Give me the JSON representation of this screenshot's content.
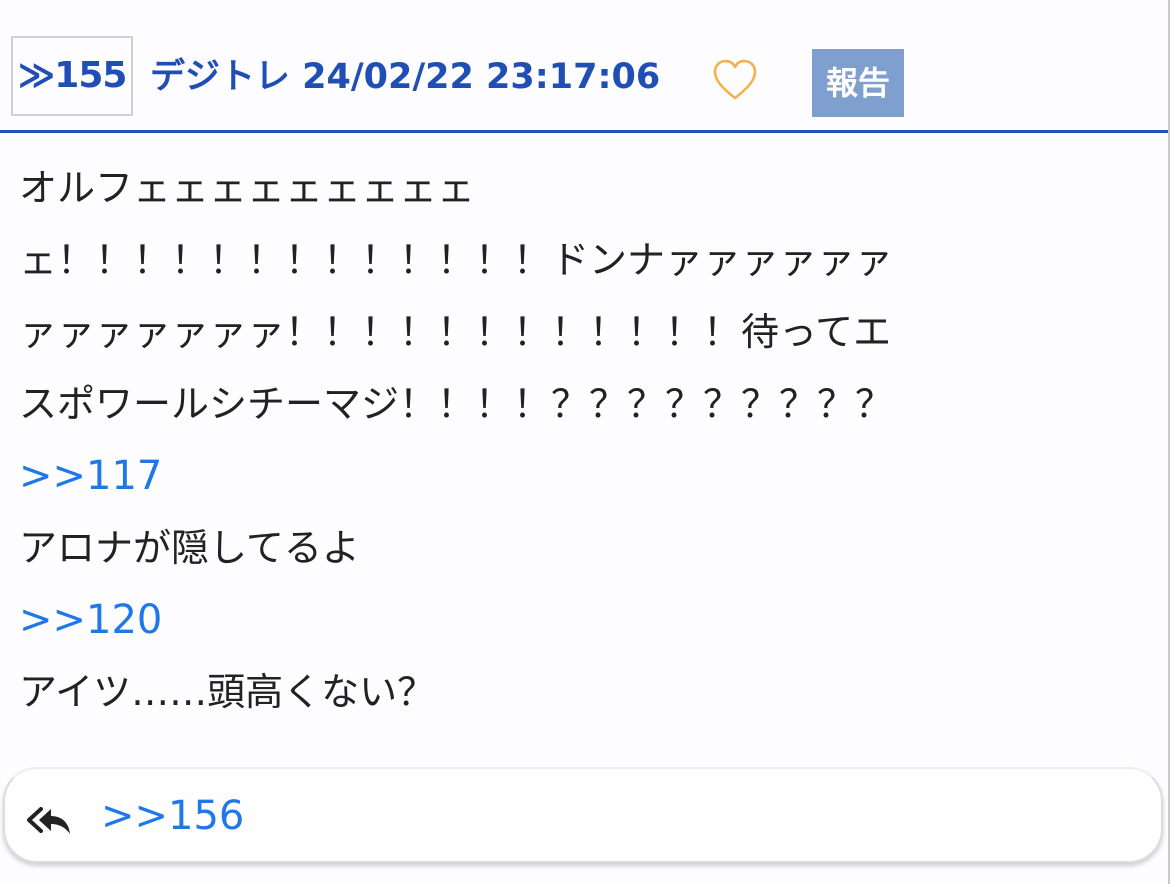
{
  "post": {
    "number": "≫155",
    "author_datetime": "デジトレ 24/02/22 23:17:06",
    "report_label": "報告",
    "body": {
      "line1": "オルフェェェェェェェェェ",
      "line2": "ェ！！！！！！！！！！！！！ドンナァァァァァァ",
      "line3": "ァァァァァァァ！！！！！！！！！！！！待ってエ",
      "line4": "スポワールシチーマジ！！！！？？？？？？？？？",
      "anchor1": ">>117",
      "reply1": "アロナが隠してるよ",
      "anchor2": ">>120",
      "reply2": "アイツ……頭高くない？"
    }
  },
  "footer": {
    "reply_anchor": ">>156"
  },
  "colors": {
    "header_blue": "#1f4fb4",
    "link_blue": "#1f78e8",
    "report_bg": "#7f9fcf",
    "heart_orange": "#f5b04a"
  },
  "icons": {
    "heart": "heart-outline-icon",
    "reply": "reply-all-icon"
  }
}
